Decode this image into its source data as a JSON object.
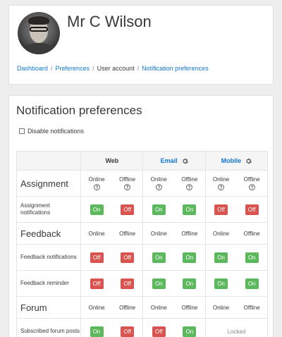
{
  "user": {
    "name": "Mr C Wilson"
  },
  "breadcrumb": [
    "Dashboard",
    "Preferences",
    "User account",
    "Notification preferences"
  ],
  "page": {
    "title": "Notification preferences",
    "disable_label": "Disable notifications",
    "disable_checked": false
  },
  "processors": [
    {
      "name": "Web",
      "configurable": false
    },
    {
      "name": "Email",
      "configurable": true
    },
    {
      "name": "Mobile",
      "configurable": true
    }
  ],
  "states": {
    "online": "Online",
    "offline": "Offline",
    "on": "On",
    "off": "Off",
    "locked": "Locked"
  },
  "sections": [
    {
      "title": "Assignment",
      "help": true,
      "items": [
        {
          "label": "Assignment notifications",
          "values": [
            "On",
            "Off",
            "On",
            "On",
            "Off",
            "Off"
          ]
        }
      ]
    },
    {
      "title": "Feedback",
      "help": false,
      "items": [
        {
          "label": "Feedback notifications",
          "values": [
            "Off",
            "Off",
            "On",
            "On",
            "On",
            "On"
          ]
        },
        {
          "label": "Feedback reminder",
          "values": [
            "Off",
            "Off",
            "On",
            "On",
            "On",
            "On"
          ]
        }
      ]
    },
    {
      "title": "Forum",
      "help": false,
      "items": [
        {
          "label": "Subscribed forum posts",
          "values": [
            "On",
            "Off",
            "Off",
            "On",
            "Locked"
          ]
        }
      ]
    }
  ],
  "colors": {
    "link": "#1177d1",
    "on": "#5cb85c",
    "off": "#d9534f"
  }
}
